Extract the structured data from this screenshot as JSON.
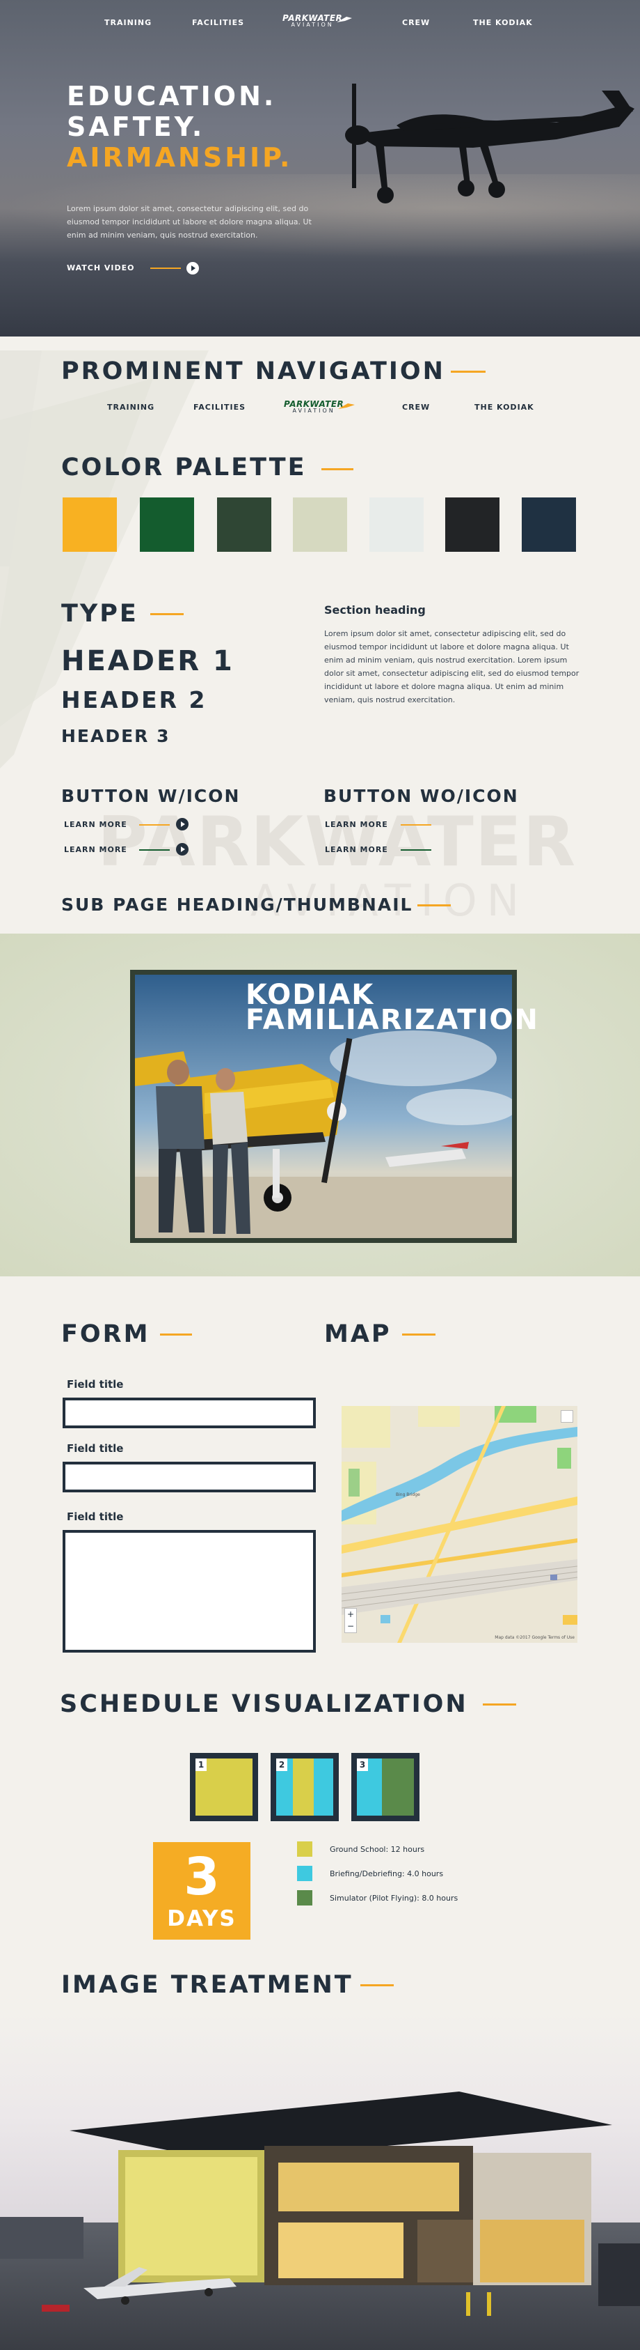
{
  "hero": {
    "nav": [
      "TRAINING",
      "FACILITIES",
      "CREW",
      "THE KODIAK"
    ],
    "logo_main": "PARKWATER",
    "logo_sub": "AVIATION",
    "title_line1": "EDUCATION.",
    "title_line2": "SAFTEY.",
    "title_line3": "AIRMANSHIP.",
    "body": "Lorem ipsum dolor sit amet, consectetur adipiscing elit, sed do eiusmod tempor incididunt ut labore et dolore magna aliqua. Ut enim ad minim veniam, quis nostrud exercitation.",
    "cta": "WATCH VIDEO"
  },
  "guide": {
    "nav_heading": "PROMINENT NAVIGATION",
    "nav": [
      "TRAINING",
      "FACILITIES",
      "CREW",
      "THE KODIAK"
    ],
    "logo_main": "PARKWATER",
    "logo_sub": "AVIATION",
    "palette_heading": "COLOR PALETTE",
    "palette": [
      "#f8b122",
      "#145c2e",
      "#2f4634",
      "#d6d9c0",
      "#e8ecea",
      "#222426",
      "#1f3142"
    ],
    "type_heading": "TYPE",
    "h1": "HEADER 1",
    "h2": "HEADER 2",
    "h3": "HEADER 3",
    "section_heading": "Section heading",
    "section_body": "Lorem ipsum dolor sit amet, consectetur adipiscing elit, sed do eiusmod tempor incididunt ut labore et dolore magna aliqua. Ut enim ad minim veniam, quis nostrud exercitation. Lorem ipsum dolor sit amet, consectetur adipiscing elit, sed do eiusmod tempor incididunt ut labore et dolore magna aliqua. Ut enim ad minim veniam, quis nostrud exercitation.",
    "btn_icon_heading": "BUTTON W/ICON",
    "btn_noicon_heading": "BUTTON WO/ICON",
    "learn_more": "LEARN MORE",
    "watermark_main": "PARKWATER",
    "watermark_sub": "AVIATION",
    "subpage_heading": "SUB PAGE HEADING/THUMBNAIL",
    "thumb_title_1": "KODIAK",
    "thumb_title_2": "FAMILIARIZATION"
  },
  "form": {
    "heading": "FORM",
    "fields": [
      "Field title",
      "Field title",
      "Field title"
    ]
  },
  "map": {
    "heading": "MAP",
    "zoom_in": "+",
    "zoom_out": "−",
    "credit": "Map data ©2017 Google   Terms of Use",
    "place": "Bing Bridge"
  },
  "schedule": {
    "heading": "SCHEDULE VISUALIZATION",
    "steps": [
      "1",
      "2",
      "3"
    ],
    "days_num": "3",
    "days_label": "DAYS",
    "legend": [
      {
        "label": "Ground School: 12 hours",
        "color": "#d9cf4a"
      },
      {
        "label": "Briefing/Debriefing: 4.0 hours",
        "color": "#3ec9e0"
      },
      {
        "label": "Simulator (Pilot Flying): 8.0 hours",
        "color": "#5a8a4a"
      }
    ]
  },
  "image_treatment": {
    "heading": "IMAGE TREATMENT"
  }
}
